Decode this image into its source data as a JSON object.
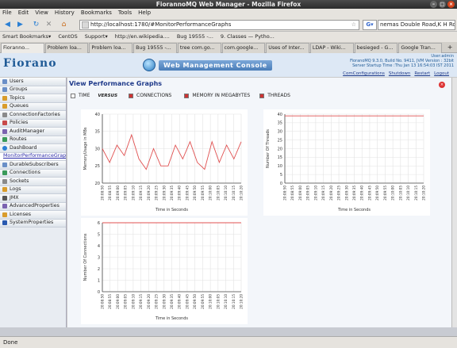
{
  "window": {
    "title": "FiorannoMQ Web Manager - Mozilla Firefox"
  },
  "menu": [
    "File",
    "Edit",
    "View",
    "History",
    "Bookmarks",
    "Tools",
    "Help"
  ],
  "nav": {
    "url": "http://localhost:1780/#MonitorPerformanceGraphs",
    "search": "nemas Double Road,K H Road"
  },
  "bookmarks": [
    "Smart Bookmarks▾",
    "CentOS",
    "Support▾",
    "http://en.wikipedia....",
    "Bug 19555 -...",
    "9. Classes — Pytho..."
  ],
  "tabs": [
    "Fioranno...",
    "Problem loa...",
    "Problem loa...",
    "Bug 19555 -...",
    "tree com.go...",
    "com.google...",
    "Uses of Inter...",
    "LDAP - Wiki...",
    "besieged - G...",
    "Google Tran..."
  ],
  "header": {
    "logo": "Fiorano",
    "console": "Web Management Console",
    "user": "User:admin",
    "build": "FioranoMQ 9.3.0, Build No. 9411, JVM Version : 32bit",
    "startup": "Server Startup Time :Thu Jan 13 16:54:03 IST 2011",
    "links": [
      "ComConfigurations",
      "Shutdown",
      "Restart",
      "Logout"
    ]
  },
  "sidebar": {
    "items": [
      "Users",
      "Groups",
      "Topics",
      "Queues",
      "ConnectionFactories",
      "Policies",
      "AuditManager",
      "Routes",
      "DashBoard"
    ],
    "active_sub": "MonitorPerformanceGraphs",
    "items2": [
      "DurableSubscribers",
      "Connections",
      "Sockets",
      "Logs",
      "JMX",
      "AdvancedProperties",
      "Licenses",
      "SystemProperties"
    ]
  },
  "page": {
    "title": "View Performance Graphs",
    "time_label": "TIME",
    "versus": "VERSUS",
    "checks": [
      "CONNECTIONS",
      "MEMORY IN MEGABYTES",
      "THREADS"
    ]
  },
  "chart_data": [
    {
      "type": "line",
      "name": "memory",
      "ylabel": "MemoryUsage in MBs",
      "xlabel": "Time in Seconds",
      "ylim": [
        20,
        40
      ],
      "yticks": [
        20,
        25,
        30,
        35,
        40
      ],
      "x": [
        "20:08:50",
        "20:08:55",
        "20:09:00",
        "20:09:05",
        "20:09:10",
        "20:09:15",
        "20:09:20",
        "20:09:25",
        "20:09:30",
        "20:09:35",
        "20:09:40",
        "20:09:45",
        "20:09:50",
        "20:09:55",
        "20:10:00",
        "20:10:05",
        "20:10:10",
        "20:10:15",
        "20:10:20"
      ],
      "values": [
        30,
        26,
        31,
        28,
        34,
        27,
        24,
        30,
        25,
        25,
        31,
        27,
        32,
        26,
        24,
        32,
        26,
        31,
        27,
        32
      ],
      "color": "#e05050",
      "grid": true
    },
    {
      "type": "line",
      "name": "threads",
      "ylabel": "Number Of Threads",
      "xlabel": "Time in Seconds",
      "ylim": [
        0,
        40
      ],
      "yticks": [
        0,
        5,
        10,
        15,
        20,
        25,
        30,
        35,
        40
      ],
      "x": [
        "20:08:50",
        "20:08:55",
        "20:09:00",
        "20:09:05",
        "20:09:10",
        "20:09:15",
        "20:09:20",
        "20:09:25",
        "20:09:30",
        "20:09:35",
        "20:09:40",
        "20:09:45",
        "20:09:50",
        "20:09:55",
        "20:10:00",
        "20:10:05",
        "20:10:10",
        "20:10:15",
        "20:10:20"
      ],
      "values": [
        39,
        39,
        39,
        39,
        39,
        39,
        39,
        39,
        39,
        39,
        39,
        39,
        39,
        39,
        39,
        39,
        39,
        39,
        39
      ],
      "color": "#e05050",
      "grid": true
    },
    {
      "type": "line",
      "name": "connections",
      "ylabel": "Number Of Connections",
      "xlabel": "Time in Seconds",
      "ylim": [
        0,
        6
      ],
      "yticks": [
        0,
        1,
        2,
        3,
        4,
        5,
        6
      ],
      "x": [
        "20:08:50",
        "20:08:55",
        "20:09:00",
        "20:09:05",
        "20:09:10",
        "20:09:15",
        "20:09:20",
        "20:09:25",
        "20:09:30",
        "20:09:35",
        "20:09:40",
        "20:09:45",
        "20:09:50",
        "20:09:55",
        "20:10:00",
        "20:10:05",
        "20:10:10",
        "20:10:15",
        "20:10:20"
      ],
      "values": [
        6,
        6,
        6,
        6,
        6,
        6,
        6,
        6,
        6,
        6,
        6,
        6,
        6,
        6,
        6,
        6,
        6,
        6,
        6
      ],
      "color": "#e05050",
      "grid": true
    }
  ],
  "status": "Done"
}
